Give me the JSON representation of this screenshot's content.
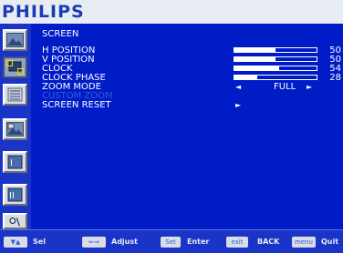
{
  "brand": "PHILIPS",
  "menu": {
    "title": "SCREEN",
    "items": [
      {
        "label": "H POSITION",
        "value": "50",
        "level": 0.5
      },
      {
        "label": "V POSITION",
        "value": "50",
        "level": 0.5
      },
      {
        "label": "CLOCK",
        "value": "54",
        "level": 0.54
      },
      {
        "label": "CLOCK PHASE",
        "value": "28",
        "level": 0.28
      }
    ],
    "zoom_mode": {
      "label": "ZOOM MODE",
      "value": "FULL",
      "left_arrow": "◄",
      "right_arrow": "►"
    },
    "custom_zoom": {
      "label": "CUSTOM ZOOM",
      "enabled": false
    },
    "screen_reset": {
      "label": "SCREEN RESET",
      "arrow": "►"
    }
  },
  "sidebar": {
    "items": [
      {
        "icon": "picture-icon",
        "active": false
      },
      {
        "icon": "screen-icon",
        "active": true
      },
      {
        "icon": "audio-icon",
        "active": false
      },
      {
        "icon": "pip-icon",
        "active": false
      },
      {
        "icon": "configuration-1-icon",
        "active": false
      },
      {
        "icon": "configuration-2-icon",
        "active": false
      },
      {
        "icon": "advanced-option-icon",
        "active": false
      }
    ]
  },
  "footer": {
    "keys": [
      {
        "key": "▼▲",
        "label": "Sel"
      },
      {
        "key": "⇐⇒",
        "label": "Adjust"
      },
      {
        "key": "Set",
        "label": "Enter"
      },
      {
        "key": "exit",
        "label": "BACK"
      },
      {
        "key": "menu",
        "label": "Quit"
      }
    ]
  },
  "colors": {
    "background": "#001cc7",
    "panel": "#1a34c8",
    "disabled_text": "#3a57d8",
    "brand": "#1a3bb4"
  }
}
